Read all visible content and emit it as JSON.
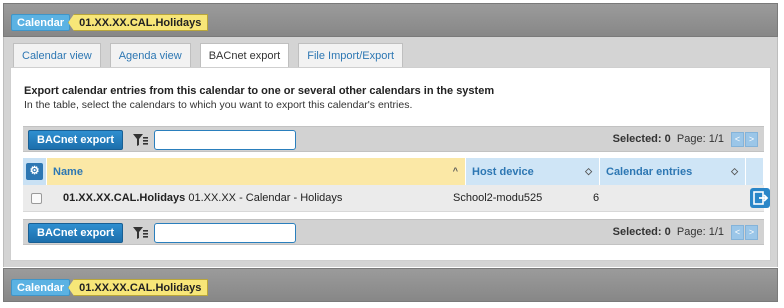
{
  "breadcrumb": {
    "calendar_label": "Calendar",
    "object_label": "01.XX.XX.CAL.Holidays"
  },
  "tabs": [
    {
      "label": "Calendar view",
      "active": false
    },
    {
      "label": "Agenda view",
      "active": false
    },
    {
      "label": "BACnet export",
      "active": true
    },
    {
      "label": "File Import/Export",
      "active": false
    }
  ],
  "content": {
    "title": "Export calendar entries from this calendar to one or several other calendars in the system",
    "subtitle": "In the table, select the calendars to which you want to export this calendar's entries."
  },
  "toolbar": {
    "export_label": "BACnet export",
    "filter_value": "",
    "selected_label": "Selected:",
    "selected_count": "0",
    "page_label": "Page:",
    "page_value": "1/1",
    "prev_glyph": "<",
    "next_glyph": ">"
  },
  "table": {
    "columns": [
      {
        "label": "Name",
        "sort": "^"
      },
      {
        "label": "Host device",
        "sort": "◇"
      },
      {
        "label": "Calendar entries",
        "sort": "◇"
      }
    ],
    "rows": [
      {
        "name_bold": "01.XX.XX.CAL.Holidays",
        "name_rest": "01.XX.XX - Calendar - Holidays",
        "host": "School2-modu525",
        "entries": "6",
        "checked": false
      }
    ]
  },
  "icons": {
    "column_settings": "gear-icon",
    "filter": "filter-icon",
    "row_action": "export-icon"
  },
  "colors": {
    "accent_blue": "#2d77b3",
    "calendar_badge": "#5bb2e3",
    "object_badge": "#f7e678",
    "name_header": "#fbe8a6",
    "header_blue": "#cfe5f6"
  }
}
